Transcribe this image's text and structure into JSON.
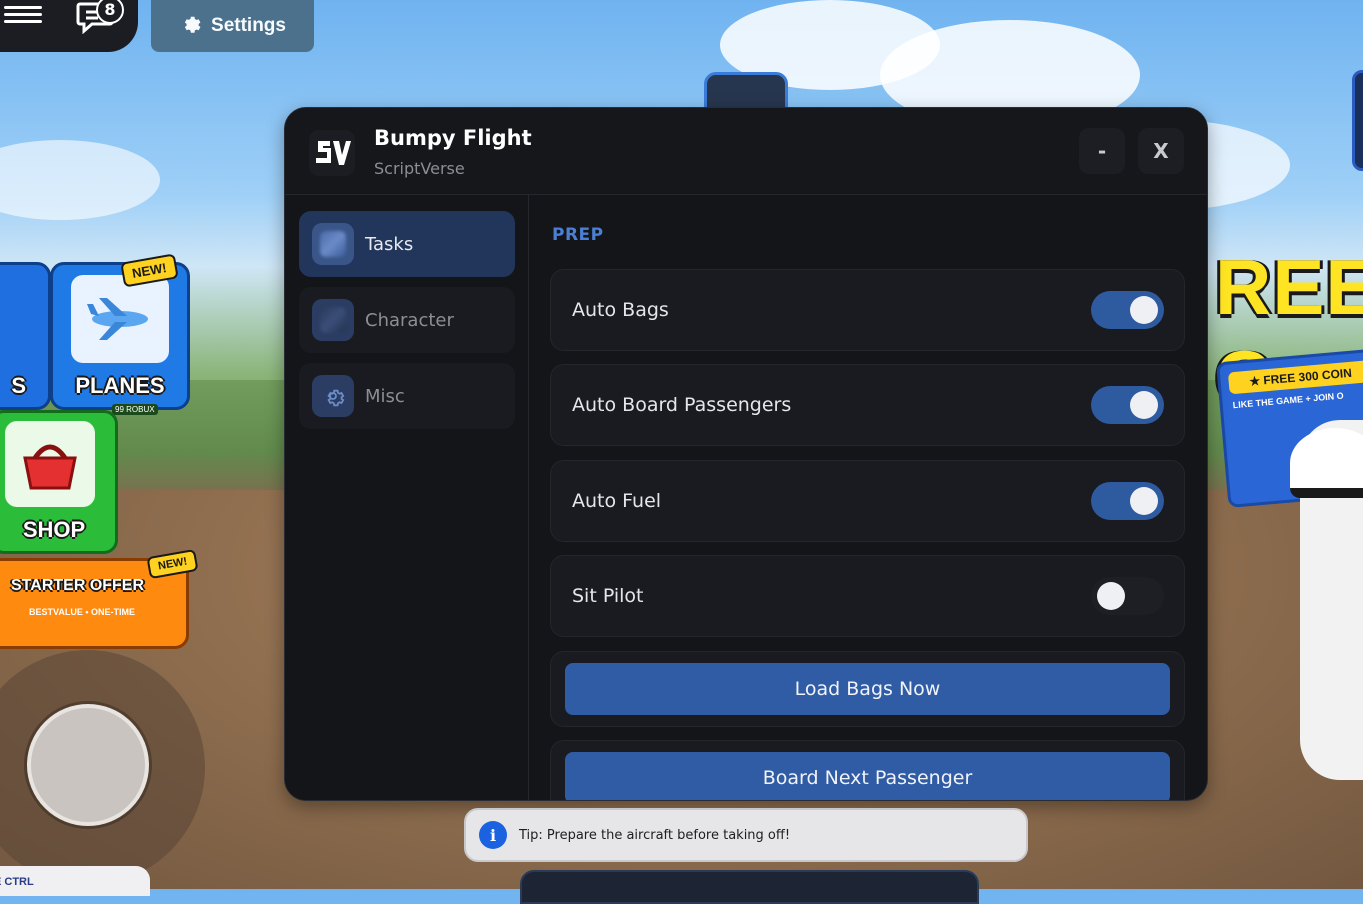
{
  "hud": {
    "chat_badge_count": "8",
    "settings_label": "Settings"
  },
  "game_tiles": {
    "planes_label": "PLANES",
    "partial_label": "S",
    "shop_label": "SHOP",
    "new_badge": "NEW!",
    "starter_offer_label": "STARTER OFFER",
    "starter_offer_sub": "BESTVALUE • ONE-TIME",
    "planes_price": "99 ROBUX"
  },
  "promo": {
    "headline": "REE C",
    "banner": "★ FREE 300 COIN",
    "sub": "LIKE THE GAME + JOIN O"
  },
  "panel": {
    "title": "Bumpy Flight",
    "subtitle": "ScriptVerse",
    "minimize_label": "-",
    "close_label": "X",
    "sidebar": {
      "items": [
        {
          "label": "Tasks",
          "icon": "blurred-tasks-icon",
          "active": true
        },
        {
          "label": "Character",
          "icon": "blurred-character-icon",
          "active": false
        },
        {
          "label": "Misc",
          "icon": "gear-icon",
          "active": false
        }
      ]
    },
    "content": {
      "section_title": "PREP",
      "toggles": [
        {
          "label": "Auto Bags",
          "on": true
        },
        {
          "label": "Auto Board Passengers",
          "on": true
        },
        {
          "label": "Auto Fuel",
          "on": true
        },
        {
          "label": "Sit Pilot",
          "on": false
        }
      ],
      "buttons": [
        {
          "label": "Load Bags Now"
        },
        {
          "label": "Board Next Passenger"
        }
      ]
    }
  },
  "tip": {
    "icon": "i",
    "text": "Tip: Prepare the aircraft before taking off!"
  },
  "bottom_left_text": "E CTRL",
  "colors": {
    "accent": "#2f5ca5",
    "section_title": "#4a7fd4",
    "panel_bg": "#141518"
  }
}
